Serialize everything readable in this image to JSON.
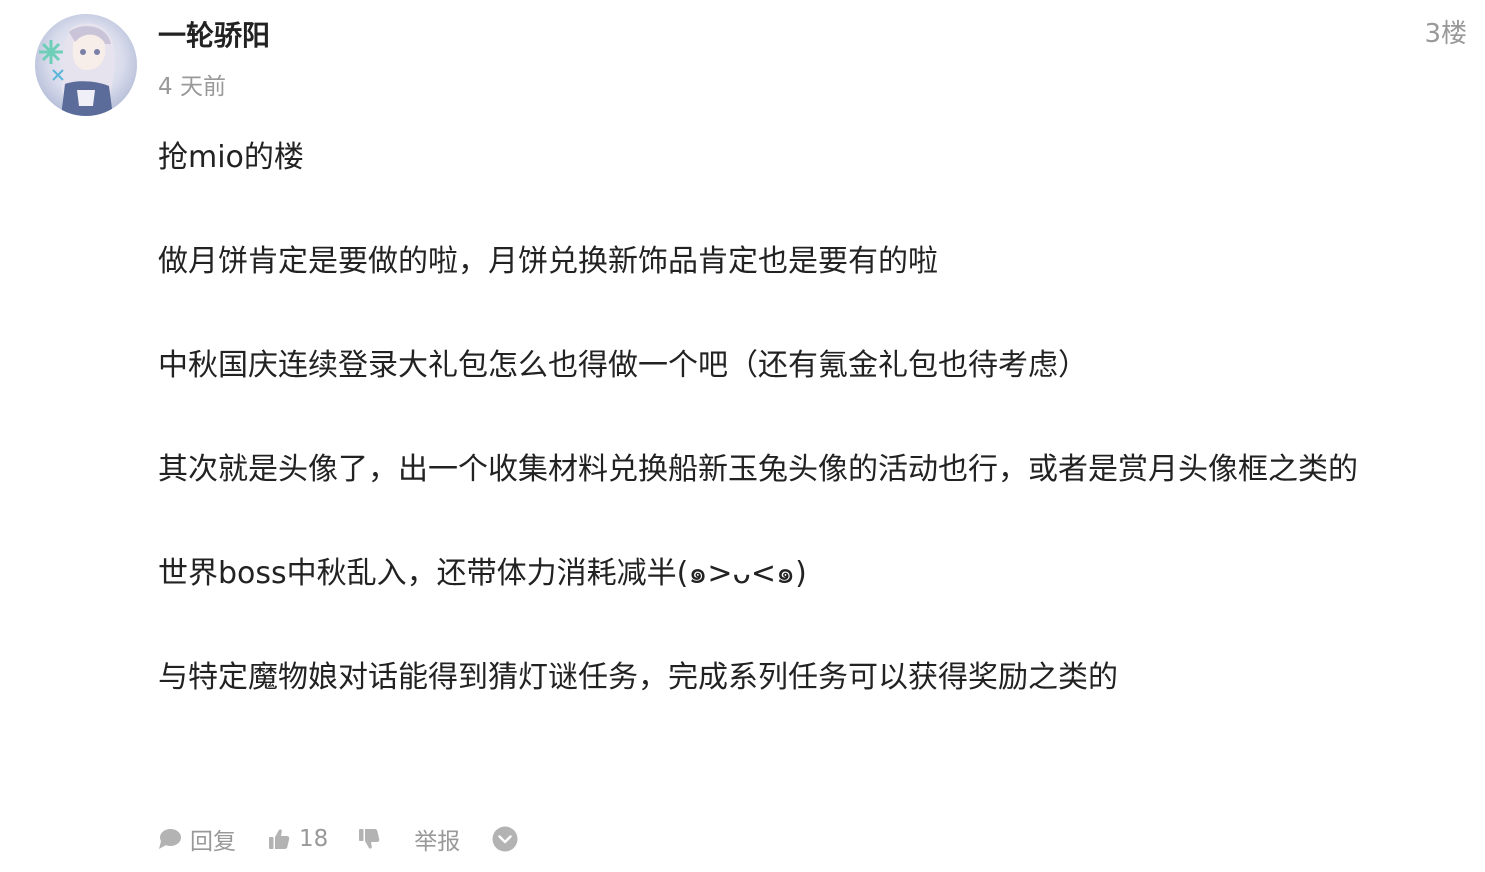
{
  "comment": {
    "username": "一轮骄阳",
    "timestamp": "4 天前",
    "floor": "3楼",
    "paragraphs": [
      "抢mio的楼",
      "做月饼肯定是要做的啦，月饼兑换新饰品肯定也是要有的啦",
      "中秋国庆连续登录大礼包怎么也得做一个吧（还有氪金礼包也待考虑）",
      "其次就是头像了，出一个收集材料兑换船新玉兔头像的活动也行，或者是赏月头像框之类的",
      "世界boss中秋乱入，还带体力消耗减半(๑>ᴗ<๑)",
      "与特定魔物娘对话能得到猜灯谜任务，完成系列任务可以获得奖励之类的"
    ]
  },
  "actions": {
    "reply_label": "回复",
    "like_count": "18",
    "report_label": "举报"
  },
  "icons": {
    "reply": "speech-bubble-icon",
    "like": "thumbs-up-icon",
    "dislike": "thumbs-down-icon",
    "more": "chevron-down-circle-icon"
  },
  "colors": {
    "text": "#222222",
    "muted": "#999999",
    "icon": "#b3b3b3"
  }
}
